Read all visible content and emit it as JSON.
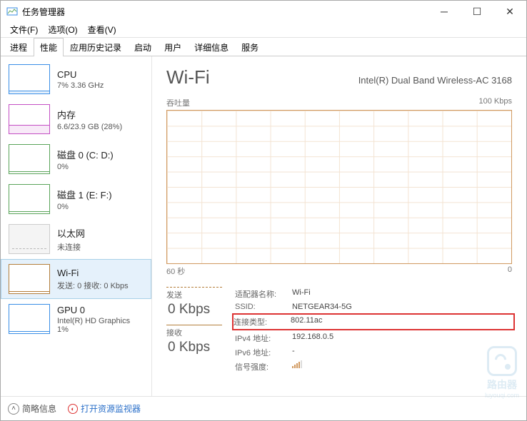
{
  "window": {
    "title": "任务管理器"
  },
  "menu": {
    "file": "文件(F)",
    "options": "选项(O)",
    "view": "查看(V)"
  },
  "tabs": {
    "items": [
      "进程",
      "性能",
      "应用历史记录",
      "启动",
      "用户",
      "详细信息",
      "服务"
    ],
    "active_index": 1
  },
  "sidebar": [
    {
      "name": "CPU",
      "sub": "7% 3.36 GHz",
      "kind": "cpu"
    },
    {
      "name": "内存",
      "sub": "6.6/23.9 GB (28%)",
      "kind": "mem"
    },
    {
      "name": "磁盘 0 (C: D:)",
      "sub": "0%",
      "kind": "disk"
    },
    {
      "name": "磁盘 1 (E: F:)",
      "sub": "0%",
      "kind": "disk"
    },
    {
      "name": "以太网",
      "sub": "未连接",
      "kind": "eth"
    },
    {
      "name": "Wi-Fi",
      "sub": "发送: 0 接收: 0 Kbps",
      "kind": "wifi",
      "selected": true
    },
    {
      "name": "GPU 0",
      "sub": "Intel(R) HD Graphics\n1%",
      "kind": "gpu"
    }
  ],
  "main": {
    "title": "Wi-Fi",
    "adapter": "Intel(R) Dual Band Wireless-AC 3168",
    "chart": {
      "label_tl": "吞吐量",
      "label_tr": "100 Kbps",
      "label_bl": "60 秒",
      "label_br": "0"
    },
    "send": {
      "label": "发送",
      "value": "0 Kbps"
    },
    "recv": {
      "label": "接收",
      "value": "0 Kbps"
    },
    "info": {
      "adapter_name_k": "适配器名称:",
      "adapter_name_v": "Wi-Fi",
      "ssid_k": "SSID:",
      "ssid_v": "NETGEAR34-5G",
      "conn_type_k": "连接类型:",
      "conn_type_v": "802.11ac",
      "ipv4_k": "IPv4 地址:",
      "ipv4_v": "192.168.0.5",
      "ipv6_k": "IPv6 地址:",
      "ipv6_v": "-",
      "signal_k": "信号强度:"
    }
  },
  "footer": {
    "brief": "简略信息",
    "monitor": "打开资源监视器"
  },
  "watermark": {
    "text": "路由器",
    "sub": "luyouqi.com"
  }
}
